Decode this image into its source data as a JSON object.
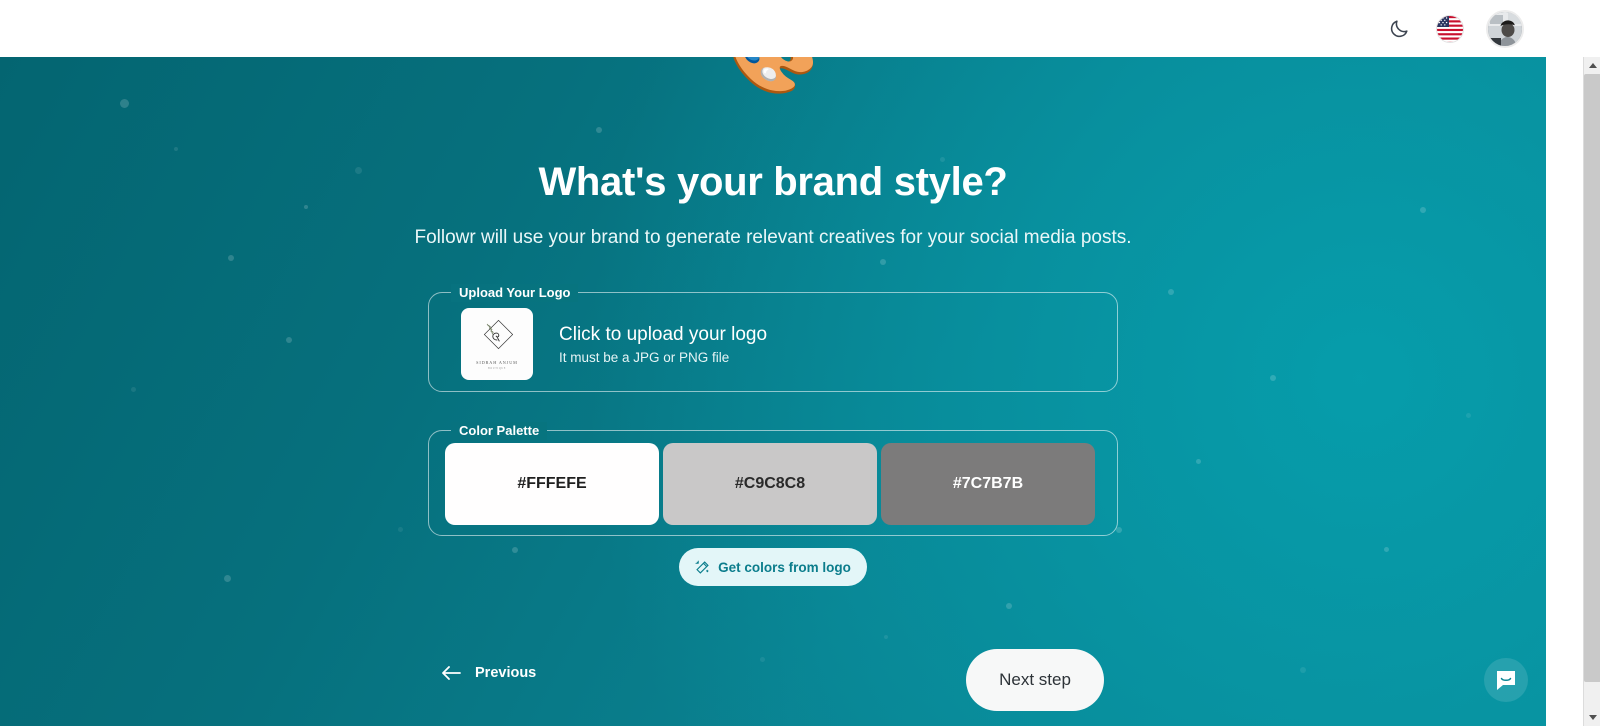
{
  "topbar": {
    "theme_toggle": "moon-icon",
    "language": "US",
    "language_icon": "us-flag-icon",
    "avatar": "user-avatar"
  },
  "hero": {
    "emoji": "🎨",
    "title": "What's your brand style?",
    "subtitle": "Followr will use your brand to generate relevant creatives for your social media posts."
  },
  "upload": {
    "legend": "Upload Your Logo",
    "title": "Click to upload your logo",
    "hint": "It must be a JPG or PNG file",
    "logo_name": "SIDRAH ANJUM",
    "logo_sub": "BOUTIQUE"
  },
  "palette": {
    "legend": "Color Palette",
    "swatches": [
      {
        "hex": "#FFFEFE",
        "label": "#FFFEFE",
        "text_color": "#1f1f1f"
      },
      {
        "hex": "#C9C8C8",
        "label": "#C9C8C8",
        "text_color": "#2a2a2a"
      },
      {
        "hex": "#7C7B7B",
        "label": "#7C7B7B",
        "text_color": "#ffffff"
      }
    ],
    "get_colors_label": "Get colors from logo",
    "get_colors_icon": "magic-wand-icon"
  },
  "footer": {
    "previous_label": "Previous",
    "previous_icon": "arrow-left-icon",
    "next_label": "Next step"
  },
  "chat": {
    "launcher_icon": "chat-bubble-icon"
  },
  "colors": {
    "background_teal_dark": "#046571",
    "background_teal_light": "#0a8b99",
    "accent": "#0b7d8c",
    "pill_bg": "#e3f6f8"
  }
}
